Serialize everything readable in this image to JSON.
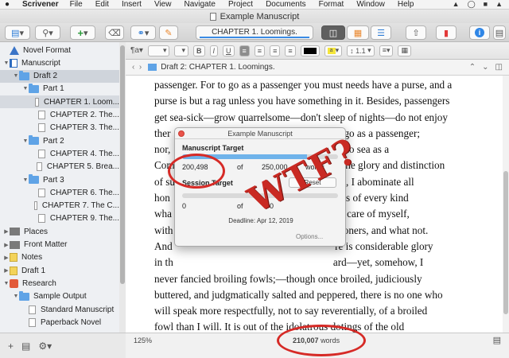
{
  "menubar": {
    "app": "Scrivener",
    "items": [
      "File",
      "Edit",
      "Insert",
      "View",
      "Navigate",
      "Project",
      "Documents",
      "Format",
      "Window",
      "Help"
    ]
  },
  "window": {
    "title": "Example Manuscript"
  },
  "toolbar": {
    "document_title": "CHAPTER 1. Loomings."
  },
  "binder": {
    "items": [
      {
        "label": "Novel Format",
        "icon": "novel-format-icon",
        "depth": 0
      },
      {
        "label": "Manuscript",
        "icon": "manuscript-icon",
        "depth": 0
      },
      {
        "label": "Draft 2",
        "icon": "folder-icon",
        "depth": 1
      },
      {
        "label": "Part 1",
        "icon": "folder-icon",
        "depth": 2
      },
      {
        "label": "CHAPTER 1. Loom...",
        "icon": "page-icon",
        "depth": 3
      },
      {
        "label": "CHAPTER 2. The...",
        "icon": "page-icon",
        "depth": 3
      },
      {
        "label": "CHAPTER 3. The...",
        "icon": "page-icon",
        "depth": 3
      },
      {
        "label": "Part 2",
        "icon": "folder-icon",
        "depth": 2
      },
      {
        "label": "CHAPTER 4. The...",
        "icon": "page-icon",
        "depth": 3
      },
      {
        "label": "CHAPTER 5. Brea...",
        "icon": "page-icon",
        "depth": 3
      },
      {
        "label": "Part 3",
        "icon": "folder-icon",
        "depth": 2
      },
      {
        "label": "CHAPTER 6. The...",
        "icon": "page-icon",
        "depth": 3
      },
      {
        "label": "CHAPTER 7. The C...",
        "icon": "page-icon",
        "depth": 3
      },
      {
        "label": "CHAPTER 9. The...",
        "icon": "page-icon",
        "depth": 3
      },
      {
        "label": "Places",
        "icon": "places-icon",
        "depth": 0
      },
      {
        "label": "Front Matter",
        "icon": "front-matter-icon",
        "depth": 0
      },
      {
        "label": "Notes",
        "icon": "notes-icon",
        "depth": 0
      },
      {
        "label": "Draft 1",
        "icon": "draft-icon",
        "depth": 0
      },
      {
        "label": "Research",
        "icon": "research-icon",
        "depth": 0
      },
      {
        "label": "Sample Output",
        "icon": "folder-icon",
        "depth": 1
      },
      {
        "label": "Standard Manuscript",
        "icon": "page-icon",
        "depth": 2
      },
      {
        "label": "Paperback Novel",
        "icon": "page-icon",
        "depth": 2
      }
    ]
  },
  "formatbar": {
    "line_spacing": "1.1"
  },
  "header": {
    "path": "Draft 2: CHAPTER 1. Loomings."
  },
  "editor": {
    "lines": [
      "passenger. For to go as a passenger you must needs have a purse, and a",
      "purse is but a rag unless you have something in it. Besides, passengers",
      "get sea-sick—grow quarrelsome—don't sleep of nights—do not enjoy",
      "ther                                                              er go as a passenger;",
      "nor,                                                              go to sea as a",
      "Com                                                             n the glory and distinction",
      "of su                                                           part, I abominate all",
      "hon                                                              ions of every kind",
      "wha                                                              ke care of myself,",
      "with                                                             hooners, and what not.",
      "And                                                              re is considerable glory",
      "in th                                                             ard—yet, somehow, I",
      "never fancied broiling fowls;—though once broiled, judiciously",
      "buttered, and judgmatically salted and peppered, there is no one who",
      "will speak more respectfully, not to say reverentially, of a broiled",
      "fowl than I will. It is out of the idolatrous dotings of the old",
      "Egyptians upon broiled ibis and roasted river horse, that you see the",
      "mummies of those creatures in their huge bake-houses the pyramids."
    ]
  },
  "footer": {
    "zoom": "125%",
    "word_count": "210,007",
    "word_unit": "words"
  },
  "popup": {
    "title": "Example Manuscript",
    "manuscript_heading": "Manuscript Target",
    "manuscript_progress": 0.8,
    "manuscript_count": "200,498",
    "of_label": "of",
    "manuscript_target": "250,000",
    "words_label": "words",
    "session_heading": "Session Target",
    "reset_label": "Reset",
    "session_progress": 0,
    "session_count": "0",
    "session_target": "0",
    "deadline": "Deadline: Apr 12, 2019",
    "options_label": "Options..."
  },
  "annotation": {
    "text": "WTF?",
    "color": "#d62a26"
  }
}
